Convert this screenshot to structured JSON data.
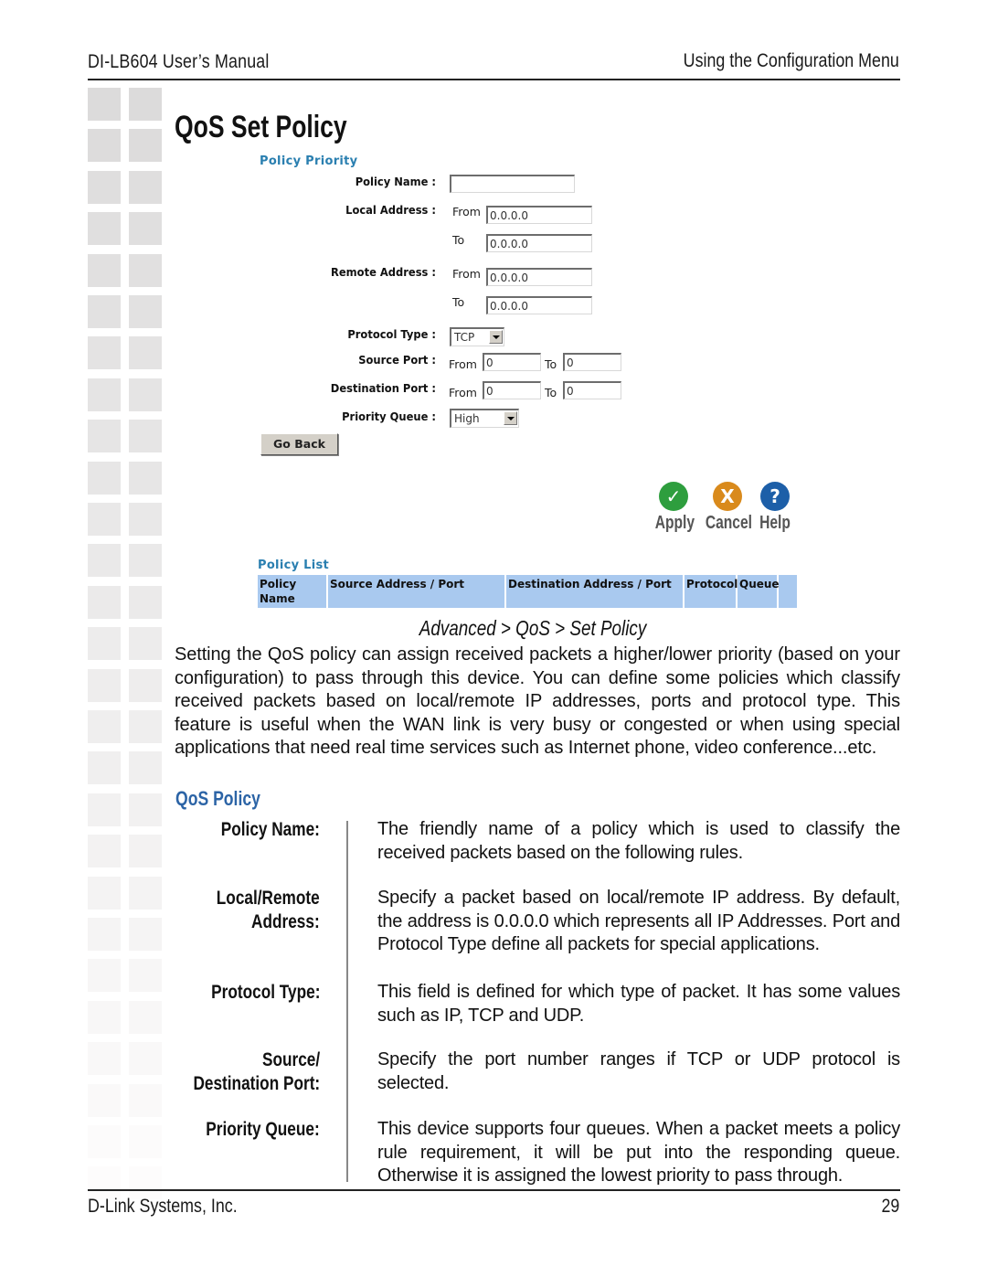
{
  "header": {
    "manual_title": "DI-LB604 User’s Manual",
    "section_title": "Using the Configuration Menu"
  },
  "page_title": "QoS Set Policy",
  "screenshot": {
    "policy_priority": {
      "title": "Policy Priority",
      "fields": {
        "policy_name": {
          "label": "Policy Name :",
          "value": ""
        },
        "local_address": {
          "label": "Local Address :",
          "from_label": "From",
          "from_value": "0.0.0.0",
          "to_label": "To",
          "to_value": "0.0.0.0"
        },
        "remote_address": {
          "label": "Remote Address :",
          "from_label": "From",
          "from_value": "0.0.0.0",
          "to_label": "To",
          "to_value": "0.0.0.0"
        },
        "protocol_type": {
          "label": "Protocol Type :",
          "selected": "TCP"
        },
        "source_port": {
          "label": "Source Port :",
          "from_label": "From",
          "from_value": "0",
          "to_label": "To",
          "to_value": "0"
        },
        "destination_port": {
          "label": "Destination Port :",
          "from_label": "From",
          "from_value": "0",
          "to_label": "To",
          "to_value": "0"
        },
        "priority_queue": {
          "label": "Priority Queue :",
          "selected": "High"
        }
      },
      "go_back_label": "Go Back"
    },
    "actions": {
      "apply": {
        "label": "Apply",
        "icon": "check-icon",
        "glyph": "✓",
        "color": "#2e9e3e"
      },
      "cancel": {
        "label": "Cancel",
        "icon": "x-icon",
        "glyph": "X",
        "color": "#d98a1c"
      },
      "help": {
        "label": "Help",
        "icon": "question-icon",
        "glyph": "?",
        "color": "#1d5fa8"
      }
    },
    "policy_list": {
      "title": "Policy List",
      "columns": [
        "Policy Name",
        "Source Address / Port",
        "Destination Address / Port",
        "Protocol",
        "Queue",
        ""
      ]
    }
  },
  "caption": "Advanced > QoS > Set Policy",
  "intro_paragraph": "Setting the QoS policy can assign received packets a higher/lower priority (based on your configuration) to pass through this device. You can define some policies which classify received packets based on local/remote IP addresses, ports and protocol type. This feature is useful when the WAN link is very busy or congested or when using special applications that need real time services such as Internet phone, video conference...etc.",
  "qos_policy_heading": "QoS Policy",
  "definitions": [
    {
      "term_line1": "Policy Name:",
      "term_line2": "",
      "description": "The friendly name of a policy which is used to classify the received packets based on the following rules."
    },
    {
      "term_line1": "Local/Remote",
      "term_line2": "Address:",
      "description": "Specify a packet based on local/remote IP address. By default, the address is 0.0.0.0 which represents all IP Addresses. Port and Protocol Type define all packets for special applications."
    },
    {
      "term_line1": "Protocol Type:",
      "term_line2": "",
      "description": "This field is defined for which type of packet. It has some values such as IP, TCP and UDP."
    },
    {
      "term_line1": "Source/",
      "term_line2": "Destination Port:",
      "description": "Specify the port number ranges if TCP or UDP protocol is selected."
    },
    {
      "term_line1": "Priority Queue:",
      "term_line2": "",
      "description": "This device supports four queues. When a packet meets a policy rule requirement, it will be put into the responding queue. Otherwise it is assigned the lowest priority to pass through."
    }
  ],
  "footer": {
    "company": "D-Link Systems, Inc.",
    "page_number": "29"
  },
  "colors": {
    "section_blue": "#2a7fb0",
    "heading_blue": "#2c64a6",
    "table_header_bg": "#a9c9ef"
  }
}
